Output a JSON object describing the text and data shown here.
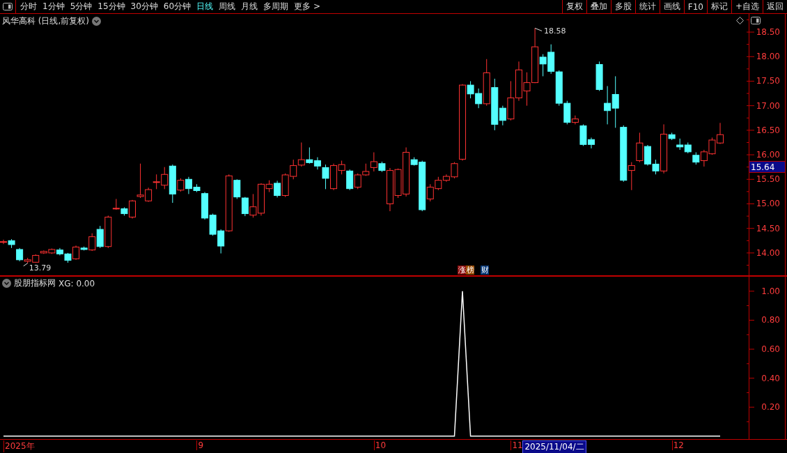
{
  "toolbar": {
    "periods": [
      {
        "label": "分时",
        "selected": false
      },
      {
        "label": "1分钟",
        "selected": false
      },
      {
        "label": "5分钟",
        "selected": false
      },
      {
        "label": "15分钟",
        "selected": false
      },
      {
        "label": "30分钟",
        "selected": false
      },
      {
        "label": "60分钟",
        "selected": false
      },
      {
        "label": "日线",
        "selected": true
      },
      {
        "label": "周线",
        "selected": false
      },
      {
        "label": "月线",
        "selected": false
      },
      {
        "label": "多周期",
        "selected": false
      },
      {
        "label": "更多 >",
        "selected": false
      }
    ],
    "buttons": [
      "复权",
      "叠加",
      "多股",
      "统计",
      "画线",
      "F10",
      "标记",
      "+自选",
      "返回"
    ]
  },
  "price_pane": {
    "title": "风华高科 (日线,前复权)",
    "price_tag": "15.64",
    "badges": [
      {
        "label": "涨",
        "color": "#8b0a0a"
      },
      {
        "label": "榜",
        "color": "#9a4a00"
      },
      {
        "label": "财",
        "color": "#0a3a78"
      }
    ],
    "chart_data": {
      "type": "candlestick",
      "ylim": [
        13.53,
        18.87
      ],
      "yticks": [
        {
          "value": 14,
          "label": "14.00"
        },
        {
          "value": 14.5,
          "label": "14.50"
        },
        {
          "value": 15,
          "label": "15.00"
        },
        {
          "value": 15.5,
          "label": "15.50"
        },
        {
          "value": 16,
          "label": "16.00"
        },
        {
          "value": 16.5,
          "label": "16.50"
        },
        {
          "value": 17,
          "label": "17.00"
        },
        {
          "value": 17.5,
          "label": "17.50"
        },
        {
          "value": 18,
          "label": "18.00"
        },
        {
          "value": 18.5,
          "label": "18.50"
        }
      ],
      "categories": [
        null,
        null,
        null,
        null,
        null,
        null,
        null,
        null,
        null,
        null,
        null,
        null,
        null,
        null,
        null,
        null,
        null,
        null,
        null,
        null,
        null,
        null,
        null,
        null,
        null,
        null,
        null,
        null,
        null,
        null,
        null,
        null,
        null,
        null,
        null,
        null,
        null,
        null,
        null,
        null,
        null,
        null,
        null,
        null,
        null,
        null,
        null,
        null,
        null,
        null,
        null,
        null,
        null,
        null,
        null,
        null,
        null,
        null,
        null,
        null,
        null,
        null,
        null,
        null,
        null,
        null,
        null,
        null,
        null,
        null,
        null,
        null,
        null,
        null,
        null,
        null,
        null,
        null,
        null,
        null,
        null,
        null,
        null,
        null,
        null,
        null,
        null,
        null,
        null,
        null
      ],
      "ohlc": [
        [
          14.22,
          14.27,
          14.18,
          14.23
        ],
        [
          14.25,
          14.28,
          14.1,
          14.17
        ],
        [
          14.07,
          14.1,
          13.83,
          13.86
        ],
        [
          13.83,
          13.9,
          13.79,
          13.86
        ],
        [
          13.81,
          13.97,
          13.8,
          13.95
        ],
        [
          14.0,
          14.05,
          13.98,
          14.03
        ],
        [
          14.0,
          14.09,
          13.98,
          14.07
        ],
        [
          14.06,
          14.1,
          13.95,
          13.98
        ],
        [
          13.98,
          14.0,
          13.8,
          13.85
        ],
        [
          13.88,
          14.15,
          13.86,
          14.12
        ],
        [
          14.1,
          14.13,
          14.05,
          14.07
        ],
        [
          14.06,
          14.4,
          14.04,
          14.33
        ],
        [
          14.48,
          14.55,
          14.1,
          14.13
        ],
        [
          14.13,
          14.76,
          14.1,
          14.73
        ],
        [
          14.9,
          15.1,
          14.88,
          14.91
        ],
        [
          14.9,
          14.93,
          14.76,
          14.8
        ],
        [
          14.73,
          15.08,
          14.7,
          15.06
        ],
        [
          15.15,
          15.82,
          15.12,
          15.18
        ],
        [
          15.06,
          15.33,
          15.04,
          15.29
        ],
        [
          15.44,
          15.6,
          15.3,
          15.45
        ],
        [
          15.38,
          15.75,
          15.3,
          15.6
        ],
        [
          15.77,
          15.8,
          15.02,
          15.2
        ],
        [
          15.28,
          15.52,
          15.25,
          15.48
        ],
        [
          15.5,
          15.55,
          15.2,
          15.31
        ],
        [
          15.34,
          15.4,
          15.24,
          15.27
        ],
        [
          15.21,
          15.24,
          14.68,
          14.71
        ],
        [
          14.77,
          14.8,
          14.35,
          14.38
        ],
        [
          14.45,
          14.48,
          13.99,
          14.14
        ],
        [
          14.45,
          15.6,
          14.43,
          15.57
        ],
        [
          15.48,
          15.5,
          15.1,
          15.14
        ],
        [
          15.12,
          15.14,
          14.75,
          14.8
        ],
        [
          14.77,
          15.2,
          14.72,
          14.94
        ],
        [
          14.81,
          15.42,
          14.76,
          15.4
        ],
        [
          15.31,
          15.48,
          15.24,
          15.4
        ],
        [
          15.42,
          15.47,
          15.13,
          15.17
        ],
        [
          15.17,
          15.62,
          15.14,
          15.59
        ],
        [
          15.56,
          15.9,
          15.5,
          15.78
        ],
        [
          15.79,
          16.25,
          15.76,
          15.9
        ],
        [
          15.9,
          16.15,
          15.82,
          15.84
        ],
        [
          15.88,
          15.95,
          15.7,
          15.77
        ],
        [
          15.74,
          15.8,
          15.3,
          15.52
        ],
        [
          15.31,
          15.82,
          15.28,
          15.78
        ],
        [
          15.68,
          15.88,
          15.6,
          15.8
        ],
        [
          15.67,
          15.7,
          15.28,
          15.31
        ],
        [
          15.34,
          15.62,
          15.3,
          15.59
        ],
        [
          15.59,
          15.82,
          15.57,
          15.66
        ],
        [
          15.74,
          16.05,
          15.66,
          15.86
        ],
        [
          15.82,
          15.86,
          15.65,
          15.68
        ],
        [
          15.0,
          15.73,
          14.85,
          15.68
        ],
        [
          15.17,
          15.72,
          15.12,
          15.7
        ],
        [
          15.2,
          16.15,
          15.15,
          16.05
        ],
        [
          15.9,
          15.95,
          15.78,
          15.8
        ],
        [
          15.85,
          15.88,
          14.85,
          14.88
        ],
        [
          15.1,
          15.4,
          15.05,
          15.34
        ],
        [
          15.31,
          15.55,
          15.28,
          15.48
        ],
        [
          15.48,
          15.6,
          15.45,
          15.56
        ],
        [
          15.55,
          15.85,
          15.52,
          15.82
        ],
        [
          15.91,
          17.44,
          15.88,
          17.42
        ],
        [
          17.42,
          17.5,
          17.15,
          17.24
        ],
        [
          17.25,
          17.35,
          16.95,
          17.04
        ],
        [
          17.04,
          17.95,
          17.0,
          17.67
        ],
        [
          17.37,
          17.55,
          16.5,
          16.62
        ],
        [
          16.95,
          17.0,
          16.6,
          16.7
        ],
        [
          16.73,
          17.5,
          16.7,
          17.16
        ],
        [
          17.16,
          17.9,
          17.1,
          17.73
        ],
        [
          17.3,
          17.68,
          17.0,
          17.47
        ],
        [
          17.47,
          18.58,
          17.46,
          18.2
        ],
        [
          17.99,
          18.05,
          17.6,
          17.85
        ],
        [
          18.09,
          18.25,
          17.65,
          17.7
        ],
        [
          17.69,
          17.72,
          17.0,
          17.05
        ],
        [
          17.05,
          17.1,
          16.62,
          16.66
        ],
        [
          16.66,
          16.8,
          16.62,
          16.73
        ],
        [
          16.59,
          16.62,
          16.18,
          16.21
        ],
        [
          16.31,
          16.35,
          16.13,
          16.21
        ],
        [
          17.84,
          17.9,
          17.3,
          17.33
        ],
        [
          17.05,
          17.4,
          16.62,
          16.9
        ],
        [
          17.23,
          17.6,
          16.55,
          16.95
        ],
        [
          16.56,
          16.6,
          15.45,
          15.48
        ],
        [
          15.68,
          15.85,
          15.28,
          15.78
        ],
        [
          15.88,
          16.45,
          15.85,
          16.24
        ],
        [
          16.17,
          16.2,
          15.78,
          15.81
        ],
        [
          15.81,
          15.9,
          15.6,
          15.67
        ],
        [
          15.67,
          16.62,
          15.62,
          16.42
        ],
        [
          16.41,
          16.45,
          16.3,
          16.33
        ],
        [
          16.2,
          16.33,
          16.1,
          16.16
        ],
        [
          16.2,
          16.25,
          16.03,
          16.06
        ],
        [
          15.99,
          16.05,
          15.8,
          15.85
        ],
        [
          15.88,
          16.1,
          15.76,
          16.06
        ],
        [
          16.02,
          16.35,
          16.0,
          16.3
        ],
        [
          16.24,
          16.65,
          16.22,
          16.41
        ]
      ],
      "annotations": [
        "18.58",
        "13.79"
      ]
    }
  },
  "indicator_pane": {
    "name": "股朋指标网",
    "reading": "XG: 0.00",
    "chart_data": {
      "type": "line",
      "ylim": [
        -0.02,
        1.105
      ],
      "categories": [
        null,
        null,
        null,
        null,
        null,
        null,
        null,
        null,
        null,
        null,
        null,
        null,
        null,
        null,
        null,
        null,
        null,
        null,
        null,
        null,
        null,
        null,
        null,
        null,
        null,
        null,
        null,
        null,
        null,
        null,
        null,
        null,
        null,
        null,
        null,
        null,
        null,
        null,
        null,
        null,
        null,
        null,
        null,
        null,
        null,
        null,
        null,
        null,
        null,
        null,
        null,
        null,
        null,
        null,
        null,
        null,
        null,
        null,
        null,
        null,
        null,
        null,
        null,
        null,
        null,
        null,
        null,
        null,
        null,
        null,
        null,
        null,
        null,
        null,
        null,
        null,
        null,
        null,
        null,
        null,
        null,
        null,
        null,
        null,
        null,
        null,
        null,
        null,
        null,
        null
      ],
      "yticks": [
        {
          "value": 0.2,
          "label": "0.20"
        },
        {
          "value": 0.4,
          "label": "0.40"
        },
        {
          "value": 0.6,
          "label": "0.60"
        },
        {
          "value": 0.8,
          "label": "0.80"
        },
        {
          "value": 1,
          "label": "1.00"
        }
      ],
      "series": [
        {
          "color": "#ffffff",
          "values": [
            0,
            0,
            0,
            0,
            0,
            0,
            0,
            0,
            0,
            0,
            0,
            0,
            0,
            0,
            0,
            0,
            0,
            0,
            0,
            0,
            0,
            0,
            0,
            0,
            0,
            0,
            0,
            0,
            0,
            0,
            0,
            0,
            0,
            0,
            0,
            0,
            0,
            0,
            0,
            0,
            0,
            0,
            0,
            0,
            0,
            0,
            0,
            0,
            0,
            0,
            0,
            0,
            0,
            0,
            0,
            0,
            0,
            1,
            0,
            0,
            0,
            0,
            0,
            0,
            0,
            0,
            0,
            0,
            0,
            0,
            0,
            0,
            0,
            0,
            0,
            0,
            0,
            0,
            0,
            0,
            0,
            0,
            0,
            0,
            0,
            0,
            0,
            0,
            0,
            0
          ]
        }
      ]
    }
  },
  "x_axis": {
    "labels": [
      "2025年",
      "9",
      "10",
      "11",
      "12"
    ],
    "cursor_date": "2025/11/04/二"
  }
}
